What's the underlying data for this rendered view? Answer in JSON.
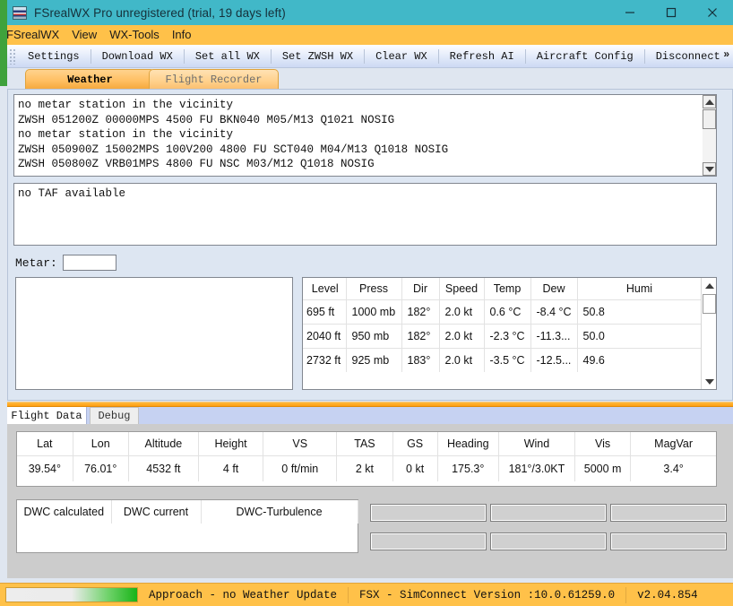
{
  "window": {
    "title": "FSrealWX Pro unregistered (trial, 19 days left)",
    "titlebar_color": "#41b8c8",
    "minimize": "minimize-icon",
    "maximize": "maximize-icon",
    "close": "close-icon"
  },
  "menubar": {
    "accent_color": "#ffc149",
    "items": [
      {
        "label": "FSrealWX"
      },
      {
        "label": "View"
      },
      {
        "label": "WX-Tools"
      },
      {
        "label": "Info"
      }
    ]
  },
  "toolbar": {
    "buttons": [
      {
        "label": "Settings"
      },
      {
        "label": "Download WX"
      },
      {
        "label": "Set all WX"
      },
      {
        "label": "Set ZWSH WX"
      },
      {
        "label": "Clear WX"
      },
      {
        "label": "Refresh AI"
      },
      {
        "label": "Aircraft Config"
      },
      {
        "label": "Disconnect"
      }
    ],
    "overflow": "»"
  },
  "tabs": {
    "active": "Weather",
    "items": [
      {
        "label": "Weather",
        "active": true
      },
      {
        "label": "Flight Recorder",
        "active": false
      }
    ]
  },
  "weather": {
    "metar_lines": [
      "no metar station in the vicinity",
      "ZWSH 051200Z 00000MPS 4500 FU BKN040 M05/M13 Q1021 NOSIG",
      "no metar station in the vicinity",
      "ZWSH 050900Z 15002MPS 100V200 4800 FU SCT040 M04/M13 Q1018 NOSIG",
      "ZWSH 050800Z VRB01MPS 4800 FU NSC M03/M12 Q1018 NOSIG"
    ],
    "taf_text": "no TAF available",
    "metar_label": "Metar:",
    "metar_input_value": "",
    "metar_input_placeholder": "",
    "notes_text": ""
  },
  "wx_table": {
    "columns": [
      "Level",
      "Press",
      "Dir",
      "Speed",
      "Temp",
      "Dew",
      "Humi"
    ],
    "rows": [
      [
        "695 ft",
        "1000 mb",
        "182°",
        "2.0 kt",
        "0.6 °C",
        "-8.4 °C",
        "50.8"
      ],
      [
        "2040 ft",
        "950 mb",
        "182°",
        "2.0 kt",
        "-2.3 °C",
        "-11.3...",
        "50.0"
      ],
      [
        "2732 ft",
        "925 mb",
        "183°",
        "2.0 kt",
        "-3.5 °C",
        "-12.5...",
        "49.6"
      ]
    ]
  },
  "bottom_tabs": {
    "items": [
      {
        "label": "Flight Data",
        "active": true
      },
      {
        "label": "Debug",
        "active": false
      }
    ]
  },
  "flight_data": {
    "columns": [
      "Lat",
      "Lon",
      "Altitude",
      "Height",
      "VS",
      "TAS",
      "GS",
      "Heading",
      "Wind",
      "Vis",
      "MagVar"
    ],
    "values": [
      "39.54°",
      "76.01°",
      "4532 ft",
      "4 ft",
      "0 ft/min",
      "2 kt",
      "0 kt",
      "175.3°",
      "181°/3.0KT",
      "5000 m",
      "3.4°"
    ]
  },
  "dwc": {
    "columns": [
      "DWC calculated",
      "DWC current",
      "DWC-Turbulence"
    ],
    "fields": [
      "",
      "",
      "",
      "",
      "",
      ""
    ]
  },
  "statusbar": {
    "progress_percent": 100,
    "status_text": "Approach - no Weather Update",
    "simconnect_text": "FSX - SimConnect Version :10.0.61259.0",
    "version_text": "v2.04.854"
  }
}
